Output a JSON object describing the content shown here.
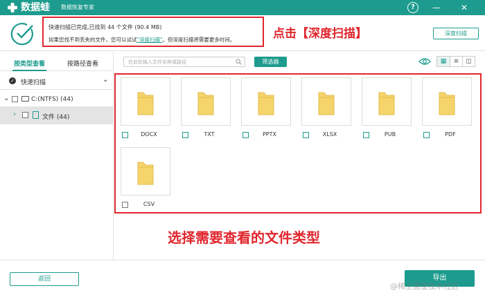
{
  "titlebar": {
    "app_name": "数据蛙",
    "subtitle": "数据恢复专家",
    "help": "?",
    "minimize": "—",
    "close": "✕"
  },
  "status": {
    "line1": "快速扫描已完成,已找到 44 个文件 (90.4 MB)",
    "line2_before": "如果您找不到丢失的文件，您可以试试",
    "line2_link": "\"深度扫描\"",
    "line2_after": "。但深度扫描将需要更多时间。",
    "deep_scan_button": "深度扫描"
  },
  "annotations": {
    "top": "点击【深度扫描】",
    "middle": "选择需要查看的文件类型"
  },
  "sidebar": {
    "tab_by_type": "按类型查看",
    "tab_by_path": "按路径查看",
    "quick_scan": "快速扫描",
    "drive": "C:(NTFS) (44)",
    "folder": "文件 (44)"
  },
  "toolbar": {
    "search_placeholder": "在此处输入文件名称或路径",
    "filter_button": "筛选器"
  },
  "files": {
    "types": [
      "DOCX",
      "TXT",
      "PPTX",
      "XLSX",
      "PUB",
      "PDF",
      "CSV"
    ]
  },
  "bottom": {
    "back_button": "返回",
    "export_button": "导出",
    "watermark": "@稀土掘金技术社区"
  },
  "colors": {
    "brand": "#1d9b8e",
    "annotation": "#e0262d",
    "folder": "#f5d46b"
  }
}
